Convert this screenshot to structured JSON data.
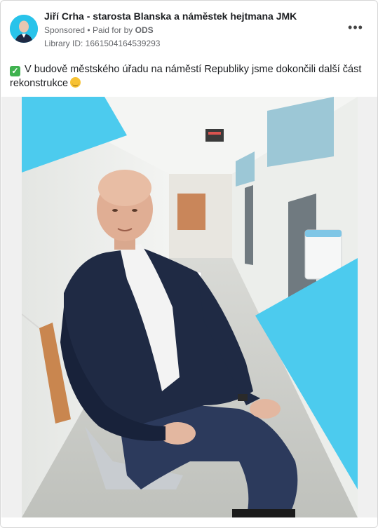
{
  "advertiser": {
    "name": "Jiří Crha - starosta Blanska a náměstek hejtmana JMK",
    "sponsored_label": "Sponsored",
    "paid_for_prefix": "Paid for by",
    "paid_for_by": "ODS",
    "library_id": "Library ID: 1661504164539293"
  },
  "menu": {
    "icon": "more-options-icon"
  },
  "post": {
    "text": "V budově městského úřadu na náměstí Republiky jsme dokončili další část rekonstrukce",
    "leading_emoji": "check-mark-icon",
    "trailing_emoji": "smiling-face-icon"
  },
  "colors": {
    "accent_cyan": "#4ccbee",
    "suit_navy": "#1f2a44",
    "jeans_blue": "#2c3a5c",
    "wall": "#eef0ee",
    "bench_wood": "#c9864f"
  }
}
